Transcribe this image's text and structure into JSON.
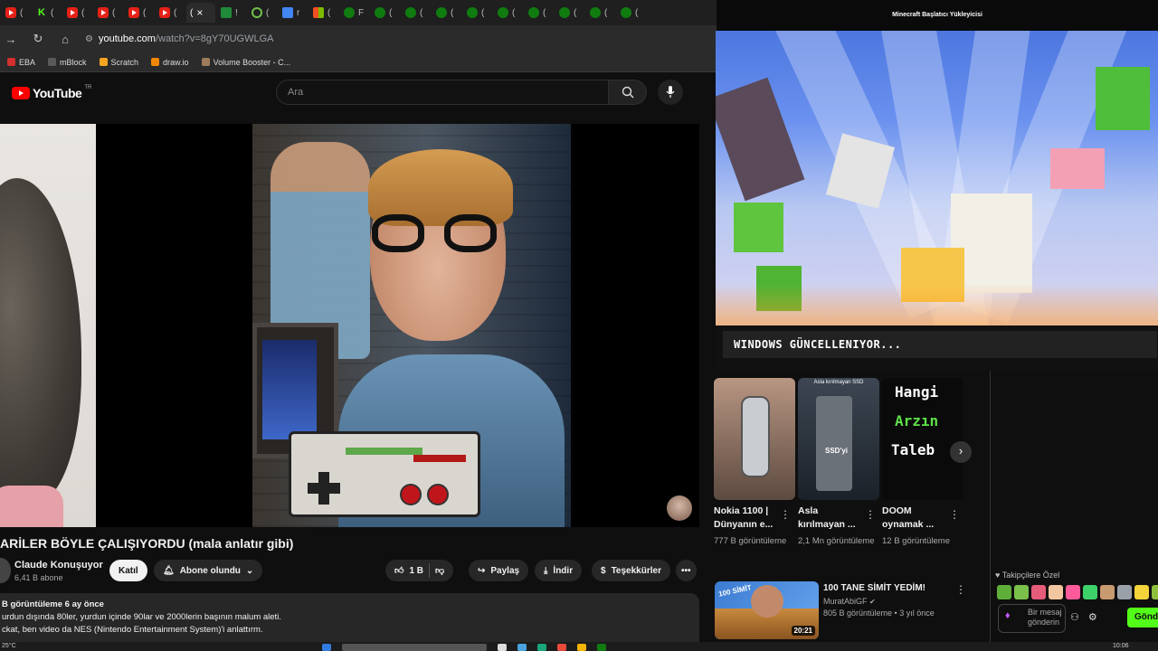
{
  "browser": {
    "tabs": [
      {
        "icon": "youtube-icon",
        "label": "("
      },
      {
        "icon": "kick-icon",
        "label": "("
      },
      {
        "icon": "youtube-icon",
        "label": "("
      },
      {
        "icon": "youtube-icon",
        "label": "("
      },
      {
        "icon": "youtube-icon",
        "label": "("
      },
      {
        "icon": "youtube-icon",
        "label": "("
      },
      {
        "icon": "youtube-icon",
        "label": "("
      },
      {
        "icon": "sheet-icon",
        "label": "!"
      },
      {
        "icon": "power-icon",
        "label": "("
      },
      {
        "icon": "doc-icon",
        "label": "r"
      },
      {
        "icon": "microsoft-icon",
        "label": "("
      },
      {
        "icon": "xbox-icon",
        "label": "F"
      },
      {
        "icon": "xbox-icon",
        "label": "("
      },
      {
        "icon": "xbox-icon",
        "label": "("
      },
      {
        "icon": "xbox-icon",
        "label": "("
      },
      {
        "icon": "xbox-icon",
        "label": "("
      },
      {
        "icon": "xbox-icon",
        "label": "("
      },
      {
        "icon": "xbox-icon",
        "label": "("
      },
      {
        "icon": "xbox-icon",
        "label": "("
      },
      {
        "icon": "xbox-icon",
        "label": "("
      },
      {
        "icon": "xbox-icon",
        "label": "("
      },
      {
        "icon": "xbox-icon",
        "label": "("
      },
      {
        "icon": "xbox-icon",
        "label": "("
      }
    ],
    "active_tab_label": "(",
    "active_tab_close": "×",
    "url_host": "youtube.com",
    "url_path": "/watch?v=8gY70UGWLGA",
    "bookmarks": [
      {
        "label": "EBA",
        "color": "#d32f2f"
      },
      {
        "label": "mBlock",
        "color": "#5a5a5a"
      },
      {
        "label": "Scratch",
        "color": "#f6a623"
      },
      {
        "label": "draw.io",
        "color": "#f08705"
      },
      {
        "label": "Volume Booster - C...",
        "color": "#9e7b5b"
      }
    ]
  },
  "youtube": {
    "logo_text": "YouTube",
    "country_code": "TR",
    "search_placeholder": "Ara",
    "video_title": "ARİLER BÖYLE ÇALIŞIYORDU (mala anlatır gibi)",
    "channel_name": "Claude Konuşuyor",
    "channel_subs": "6,41 B abone",
    "join_label": "Katıl",
    "subscribed_label": "Abone olundu",
    "likes": "1 B",
    "share_label": "Paylaş",
    "download_label": "İndir",
    "thanks_label": "Teşekkürler",
    "more_label": "•••",
    "desc_meta": "B görüntüleme  6 ay önce",
    "desc_line1": "urdun dışında 80ler, yurdun içinde 90lar ve 2000lerin başının malum aleti.",
    "desc_line2": "ckat, ben video da NES (Nintendo Entertainment System)'i anlattırm."
  },
  "overlay": {
    "mc_title": "Minecraft Başlatıcı Yükleyicisi",
    "mc_status": "WINDOWS GÜNCELLENIYOR...",
    "shorts": [
      {
        "title": "Nokia 1100 | Dünyanın e...",
        "views": "777 B görüntüleme"
      },
      {
        "title": "Asla kırılmayan ...",
        "views": "2,1 Mn görüntüleme",
        "thumb_top": "Asla kırılmayan SSD",
        "thumb_mid": "SSD'yi"
      },
      {
        "title": "DOOM oynamak ...",
        "views": "12 B görüntüleme",
        "thumb_lines": [
          "Hangi",
          "Arzın",
          "Taleb"
        ]
      }
    ],
    "rec": {
      "title": "100 TANE SİMİT YEDİM!",
      "channel": "MuratAbiGF",
      "meta": "805 B görüntüleme • 3 yıl önce",
      "duration": "20:21",
      "thumb_text": "100 SİMİT"
    },
    "chat": {
      "header": "Takipçilere Özel",
      "input_placeholder": "Bir mesaj gönderin",
      "send_label": "Gönder"
    }
  },
  "taskbar": {
    "temp": "25°C",
    "clock": "10:06"
  }
}
